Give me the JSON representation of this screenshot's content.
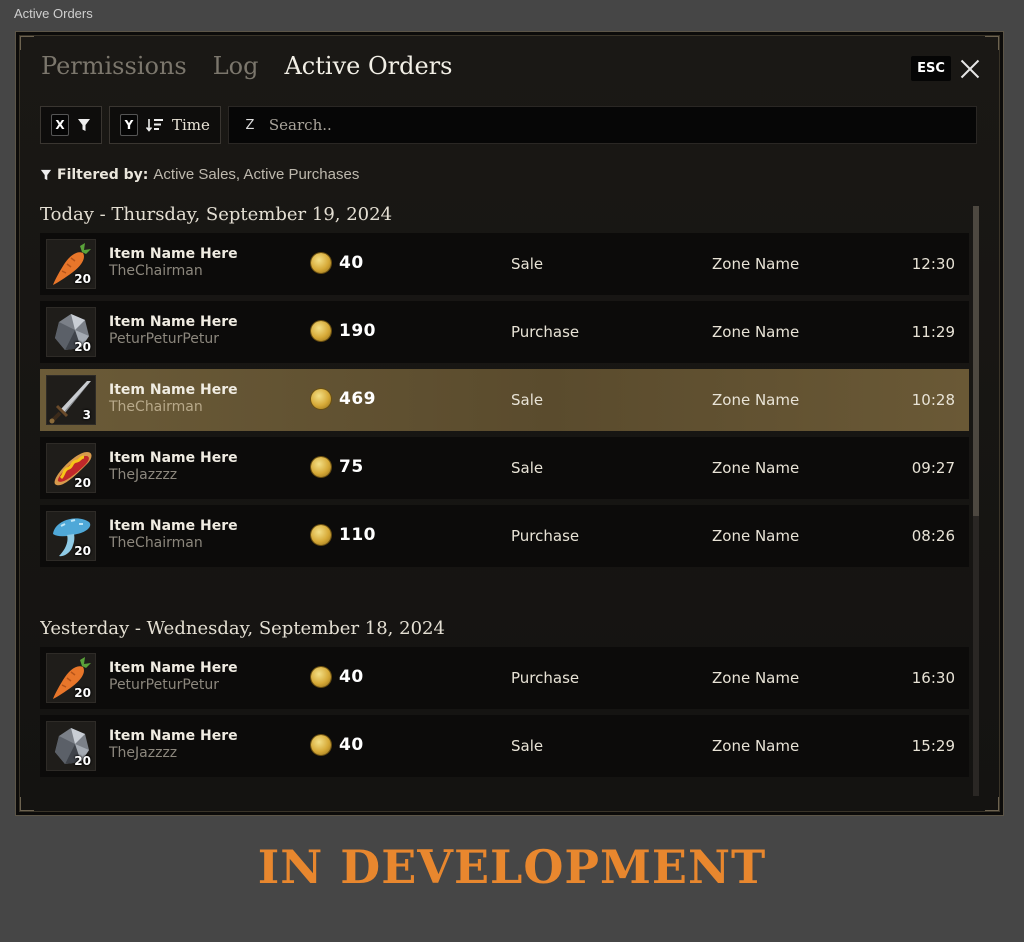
{
  "window_title": "Active Orders",
  "tabs": [
    {
      "label": "Permissions",
      "active": false
    },
    {
      "label": "Log",
      "active": false
    },
    {
      "label": "Active Orders",
      "active": true
    }
  ],
  "esc_key": "ESC",
  "toolbar": {
    "filter_key": "X",
    "sort_key": "Y",
    "sort_label": "Time",
    "search_key": "Z",
    "search_placeholder": "Search.."
  },
  "filtered": {
    "label": "Filtered by:",
    "value": "Active Sales, Active Purchases"
  },
  "groups": [
    {
      "header": "Today - Thursday, September 19, 2024",
      "rows": [
        {
          "icon": "carrot",
          "qty": "20",
          "name": "Item Name Here",
          "seller": "TheChairman",
          "price": "40",
          "type": "Sale",
          "zone": "Zone Name",
          "time": "12:30",
          "selected": false
        },
        {
          "icon": "ore",
          "qty": "20",
          "name": "Item Name Here",
          "seller": "PeturPeturPetur",
          "price": "190",
          "type": "Purchase",
          "zone": "Zone Name",
          "time": "11:29",
          "selected": false
        },
        {
          "icon": "sword",
          "qty": "3",
          "name": "Item Name Here",
          "seller": "TheChairman",
          "price": "469",
          "type": "Sale",
          "zone": "Zone Name",
          "time": "10:28",
          "selected": true
        },
        {
          "icon": "hotdog",
          "qty": "20",
          "name": "Item Name Here",
          "seller": "TheJazzzz",
          "price": "75",
          "type": "Sale",
          "zone": "Zone Name",
          "time": "09:27",
          "selected": false
        },
        {
          "icon": "mushroom",
          "qty": "20",
          "name": "Item Name Here",
          "seller": "TheChairman",
          "price": "110",
          "type": "Purchase",
          "zone": "Zone Name",
          "time": "08:26",
          "selected": false
        }
      ]
    },
    {
      "header": "Yesterday - Wednesday, September 18, 2024",
      "rows": [
        {
          "icon": "carrot",
          "qty": "20",
          "name": "Item Name Here",
          "seller": "PeturPeturPetur",
          "price": "40",
          "type": "Purchase",
          "zone": "Zone Name",
          "time": "16:30",
          "selected": false
        },
        {
          "icon": "ore",
          "qty": "20",
          "name": "Item Name Here",
          "seller": "TheJazzzz",
          "price": "40",
          "type": "Sale",
          "zone": "Zone Name",
          "time": "15:29",
          "selected": false
        }
      ]
    }
  ],
  "banner": "IN DEVELOPMENT",
  "colors": {
    "accent": "#e8872e",
    "selected_row": "#6b5b38",
    "coin": "#d6a937"
  }
}
